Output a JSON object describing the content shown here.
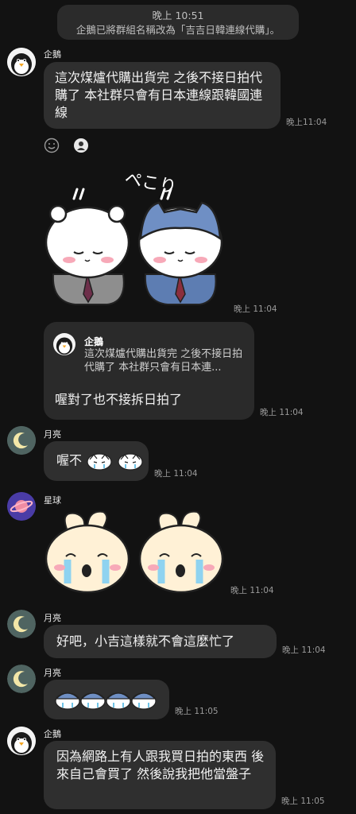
{
  "system_message": {
    "time": "晚上 10:51",
    "text": "企鵝已將群組名稱改為「吉吉日韓連線代購」。"
  },
  "messages": [
    {
      "sender": "企鵝",
      "text": "這次煤爐代購出貨完 之後不接日拍代購了 本社群只會有日本連線跟韓國連線",
      "time": "晚上11:04",
      "reactions": [
        "smile-add-icon",
        "reaction-face-icon"
      ]
    },
    {
      "type": "sticker",
      "sticker": "chiikawa-hachiware-suits-bowing",
      "sticker_text": "ペこり",
      "time": "晚上 11:04"
    },
    {
      "type": "reply",
      "quote_sender": "企鵝",
      "quote_text": "這次煤爐代購出貨完 之後不接日拍代購了 本社群只會有日本連...",
      "text": "喔對了也不接拆日拍了",
      "time": "晚上 11:04"
    },
    {
      "sender": "月亮",
      "text": "喔不",
      "emoji_count": 2,
      "time": "晚上 11:04"
    },
    {
      "sender": "星球",
      "type": "sticker",
      "sticker": "usagi-crying-pair",
      "time": "晚上 11:04"
    },
    {
      "sender": "月亮",
      "text": "好吧，小吉這樣就不會這麼忙了",
      "time": "晚上 11:04"
    },
    {
      "sender": "月亮",
      "type": "emoji",
      "emoji_count": 4,
      "time": "晚上 11:05"
    },
    {
      "sender": "企鵝",
      "text": "因為網路上有人跟我買日拍的東西 後來自己會買了 然後說我把他當盤子",
      "time": "晚上 11:05"
    }
  ],
  "colors": {
    "background": "#121212",
    "bubble": "#2f2f2f",
    "timestamp": "#9a9a9a"
  }
}
